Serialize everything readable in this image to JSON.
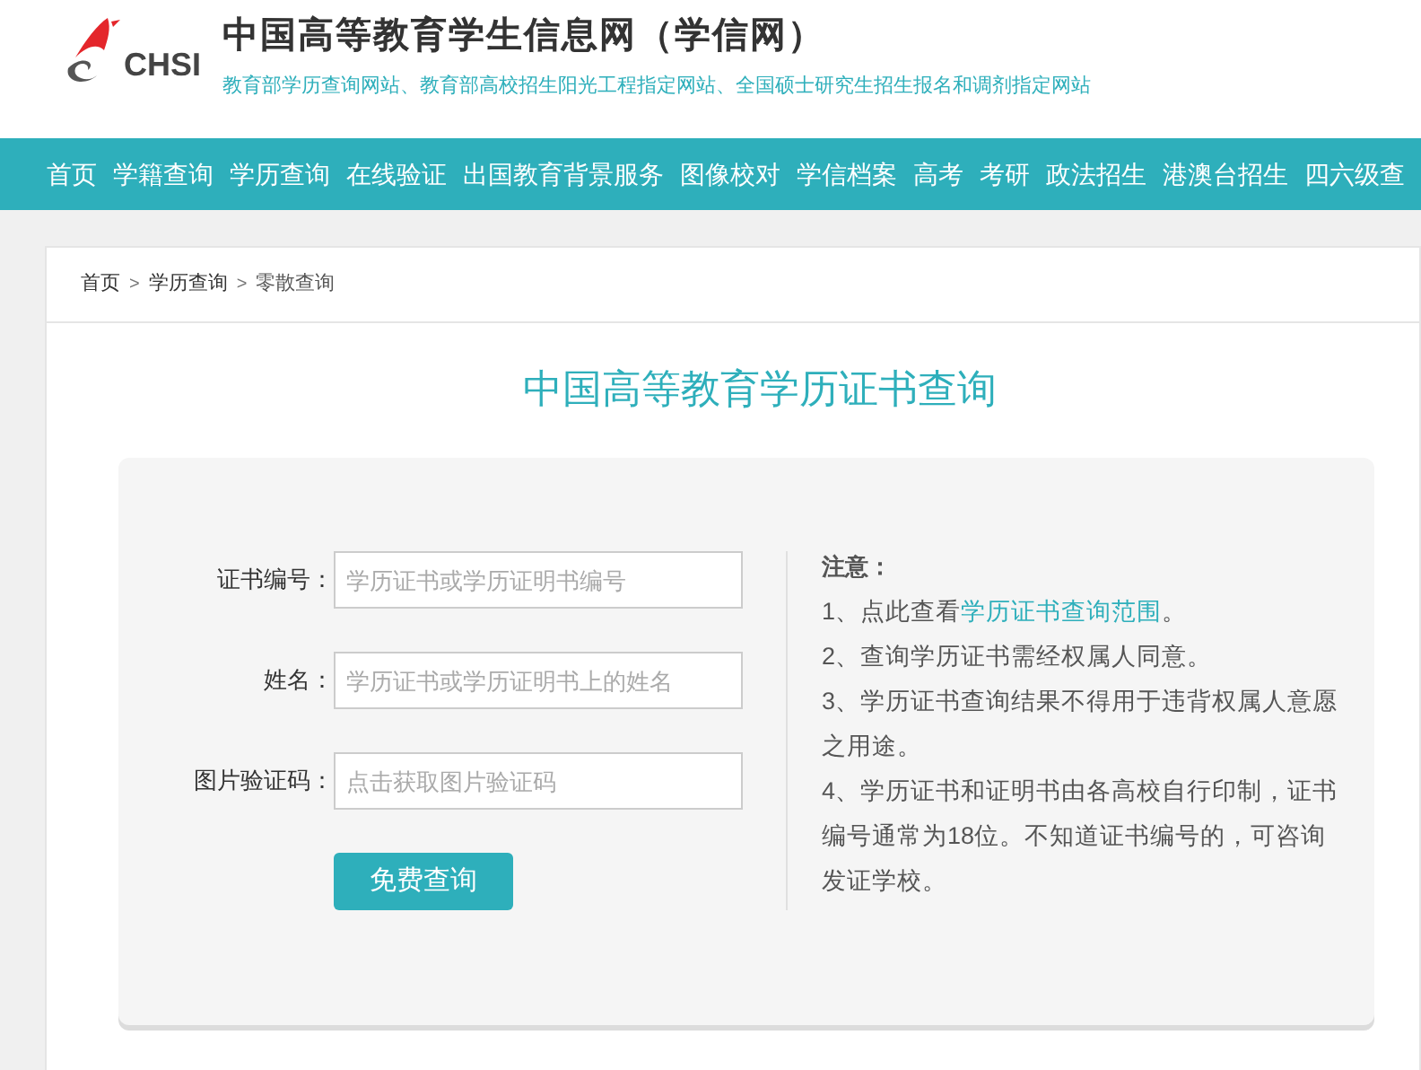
{
  "header": {
    "logo_text": "CHSI",
    "site_title": "中国高等教育学生信息网（学信网）",
    "tagline": "教育部学历查询网站、教育部高校招生阳光工程指定网站、全国硕士研究生招生报名和调剂指定网站"
  },
  "nav": [
    {
      "label": "首页"
    },
    {
      "label": "学籍查询"
    },
    {
      "label": "学历查询"
    },
    {
      "label": "在线验证"
    },
    {
      "label": "出国教育背景服务"
    },
    {
      "label": "图像校对"
    },
    {
      "label": "学信档案"
    },
    {
      "label": "高考"
    },
    {
      "label": "考研"
    },
    {
      "label": "政法招生"
    },
    {
      "label": "港澳台招生"
    },
    {
      "label": "四六级查"
    }
  ],
  "breadcrumb": [
    {
      "label": "首页"
    },
    {
      "label": "学历查询"
    },
    {
      "label": "零散查询"
    }
  ],
  "breadcrumb_separator": ">",
  "page_title": "中国高等教育学历证书查询",
  "form": {
    "fields": [
      {
        "label": "证书编号：",
        "placeholder": "学历证书或学历证明书编号"
      },
      {
        "label": "姓名：",
        "placeholder": "学历证书或学历证明书上的姓名"
      },
      {
        "label": "图片验证码：",
        "placeholder": "点击获取图片验证码"
      }
    ],
    "submit": "免费查询"
  },
  "notes": {
    "title": "注意：",
    "items": [
      {
        "text": "1、点此查看",
        "link": "学历证书查询范围",
        "after": "。"
      },
      {
        "text": "2、查询学历证书需经权属人同意。"
      },
      {
        "text": "3、学历证书查询结果不得用于违背权属人意愿之用途。"
      },
      {
        "text": "4、学历证书和证明书由各高校自行印制，证书编号通常为18位。不知道证书编号的，可咨询发证学校。"
      }
    ]
  }
}
